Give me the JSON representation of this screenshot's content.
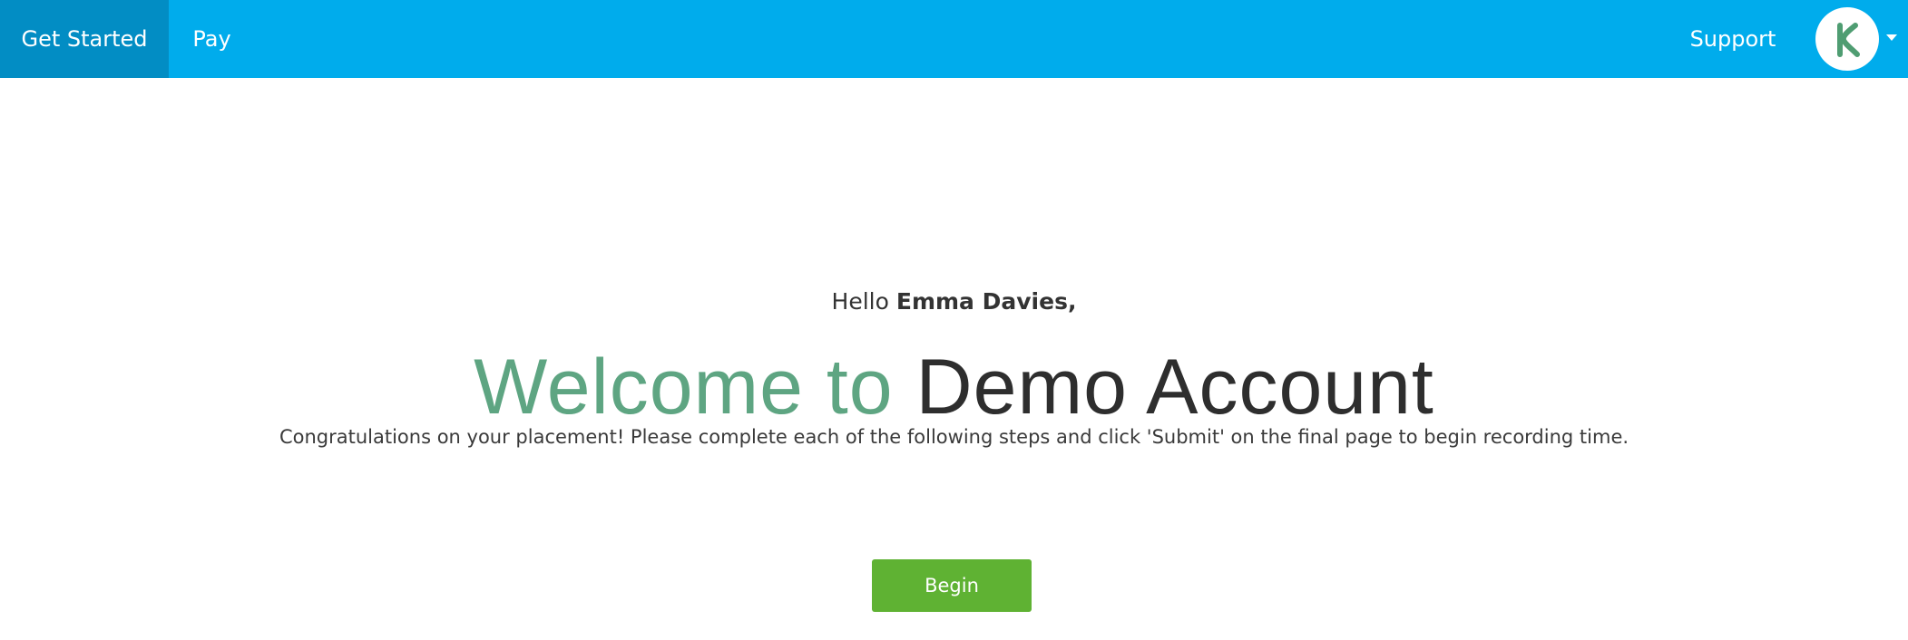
{
  "nav": {
    "items": [
      {
        "label": "Get Started",
        "active": true
      },
      {
        "label": "Pay",
        "active": false
      }
    ],
    "support_label": "Support",
    "avatar_icon": "logo-icon",
    "caret_icon": "caret-down-icon"
  },
  "greeting": {
    "prefix": "Hello ",
    "name": "Emma Davies,"
  },
  "welcome": {
    "highlight": "Welcome to",
    "account_name": "Demo Account"
  },
  "message": "Congratulations on your placement! Please complete each of the following steps and click 'Submit' on the final page to begin recording time.",
  "begin_button": {
    "label": "Begin"
  },
  "colors": {
    "navbar": "#00acec",
    "nav_active": "#028dc4",
    "welcome_green": "#5ea582",
    "logo_green": "#4f9d72",
    "button_green": "#5fb233"
  }
}
